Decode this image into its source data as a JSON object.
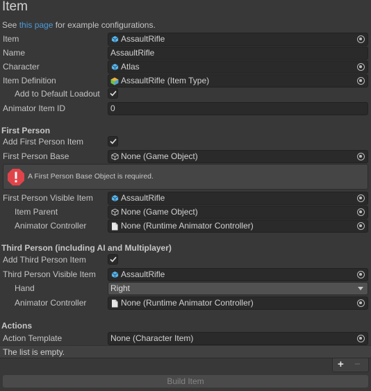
{
  "header": {
    "title": "Item",
    "see_prefix": "See ",
    "see_link": "this page",
    "see_suffix": " for example configurations."
  },
  "fields": {
    "item": {
      "label": "Item",
      "value": "AssaultRifle"
    },
    "name": {
      "label": "Name",
      "value": "AssaultRifle"
    },
    "character": {
      "label": "Character",
      "value": "Atlas"
    },
    "item_definition": {
      "label": "Item Definition",
      "value": "AssaultRifle (Item Type)"
    },
    "add_default_loadout": {
      "label": "Add to Default Loadout",
      "checked": true
    },
    "animator_item_id": {
      "label": "Animator Item ID",
      "value": "0"
    }
  },
  "first_person": {
    "heading": "First Person",
    "add_item": {
      "label": "Add First Person Item",
      "checked": true
    },
    "base": {
      "label": "First Person Base",
      "value": "None (Game Object)"
    },
    "error": "A First Person Base Object is required.",
    "visible_item": {
      "label": "First Person Visible Item",
      "value": "AssaultRifle"
    },
    "item_parent": {
      "label": "Item Parent",
      "value": "None (Game Object)"
    },
    "animator_controller": {
      "label": "Animator Controller",
      "value": "None (Runtime Animator Controller)"
    }
  },
  "third_person": {
    "heading": "Third Person (including AI and Multiplayer)",
    "add_item": {
      "label": "Add Third Person Item",
      "checked": true
    },
    "visible_item": {
      "label": "Third Person Visible Item",
      "value": "AssaultRifle"
    },
    "hand": {
      "label": "Hand",
      "value": "Right"
    },
    "animator_controller": {
      "label": "Animator Controller",
      "value": "None (Runtime Animator Controller)"
    }
  },
  "actions": {
    "heading": "Actions",
    "template": {
      "label": "Action Template",
      "value": "None (Character Item)"
    },
    "list_empty": "The list is empty.",
    "add": "+",
    "remove": "−",
    "build_button": "Build Item"
  },
  "icons": {
    "prefab": "prefab-cube-icon",
    "item_type": "item-type-icon",
    "game_object": "game-object-icon",
    "file": "file-icon",
    "picker": "object-picker-icon",
    "error": "error-icon",
    "check": "checkmark-icon"
  },
  "colors": {
    "background": "#383838",
    "field": "#2a2a2a",
    "link": "#4e9ad8",
    "error": "#e0444a",
    "prefab": "#5ab4e8"
  }
}
